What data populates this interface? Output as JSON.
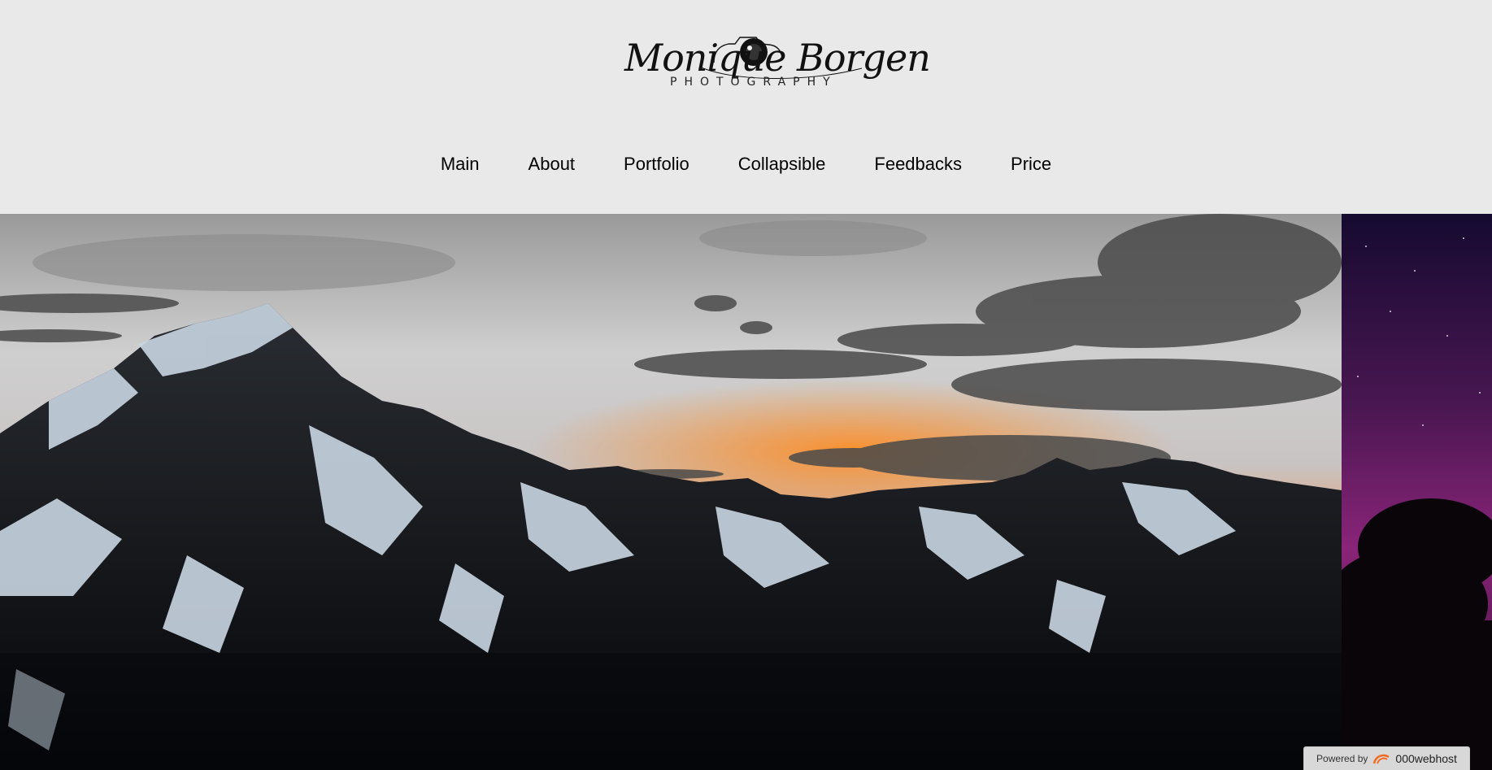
{
  "logo": {
    "name": "Monique Borgen",
    "tagline": "PHOTOGRAPHY"
  },
  "nav": [
    {
      "label": "Main"
    },
    {
      "label": "About"
    },
    {
      "label": "Portfolio"
    },
    {
      "label": "Collapsible"
    },
    {
      "label": "Feedbacks"
    },
    {
      "label": "Price"
    }
  ],
  "badge": {
    "prefix": "Powered by",
    "brand": "000webhost"
  },
  "colors": {
    "background": "#e9e9e9",
    "sunset": "#ff7a10",
    "night_sky": "#6a1a6a"
  }
}
